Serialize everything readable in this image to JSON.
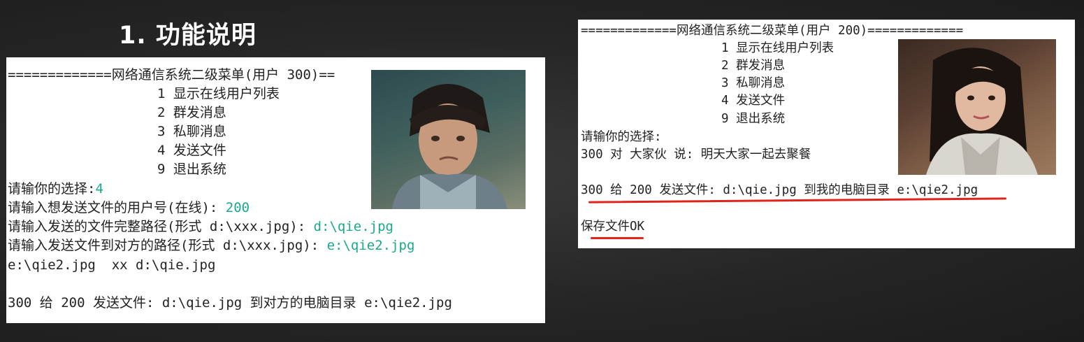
{
  "slide": {
    "title": "1. 功能说明"
  },
  "left_console": {
    "separator": "=============网络通信系统二级菜单(用户 300)==",
    "menu": [
      "1 显示在线用户列表",
      "2 群发消息",
      "3 私聊消息",
      "4 发送文件",
      "9 退出系统"
    ],
    "prompt_choice": "请输你的选择:",
    "choice_value": "4",
    "prompt_user": "请输入想发送文件的用户号(在线): ",
    "user_value": "200",
    "prompt_src": "请输入发送的文件完整路径(形式 d:\\xxx.jpg): ",
    "src_value": "d:\\qie.jpg",
    "prompt_dst": "请输入发送文件到对方的路径(形式 d:\\xxx.jpg): ",
    "dst_value": "e:\\qie2.jpg",
    "echo_line": "e:\\qie2.jpg  xx d:\\qie.jpg",
    "result_line": "300 给 200 发送文件: d:\\qie.jpg 到对方的电脑目录 e:\\qie2.jpg"
  },
  "right_console": {
    "separator": "=============网络通信系统二级菜单(用户 200)=============",
    "menu": [
      "1 显示在线用户列表",
      "2 群发消息",
      "3 私聊消息",
      "4 发送文件",
      "9 退出系统"
    ],
    "prompt_choice": "请输你的选择:",
    "group_msg": "300 对 大家伙 说: 明天大家一起去聚餐",
    "receive_line": "300 给 200 发送文件: d:\\qie.jpg 到我的电脑目录 e:\\qie2.jpg",
    "saved_line": "保存文件OK"
  },
  "colors": {
    "input": "#1aa98a",
    "underline": "#e0241b",
    "background": "#262626"
  }
}
